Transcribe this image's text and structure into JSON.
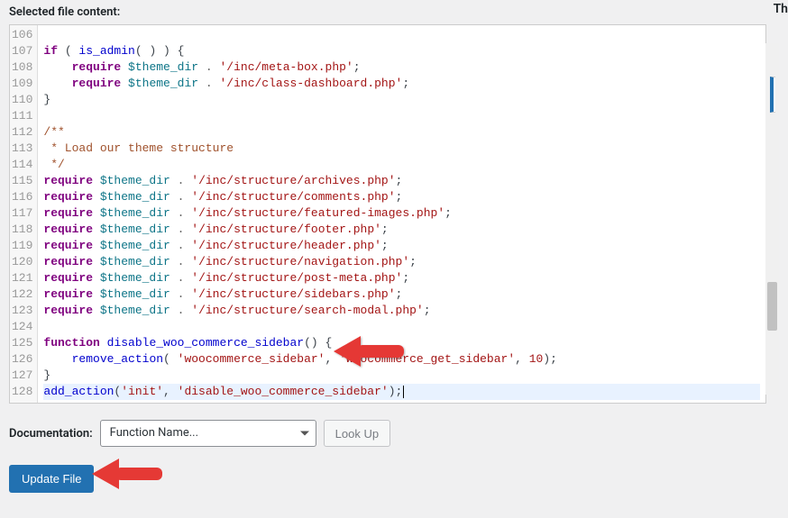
{
  "header": {
    "label": "Selected file content:"
  },
  "rightTitle": "Th",
  "code": {
    "startLine": 106,
    "highlightLine": 128,
    "cursorLine": 128
  },
  "documentation": {
    "label": "Documentation:",
    "selectPlaceholder": "Function Name...",
    "lookup": "Look Up"
  },
  "updateButton": "Update File"
}
